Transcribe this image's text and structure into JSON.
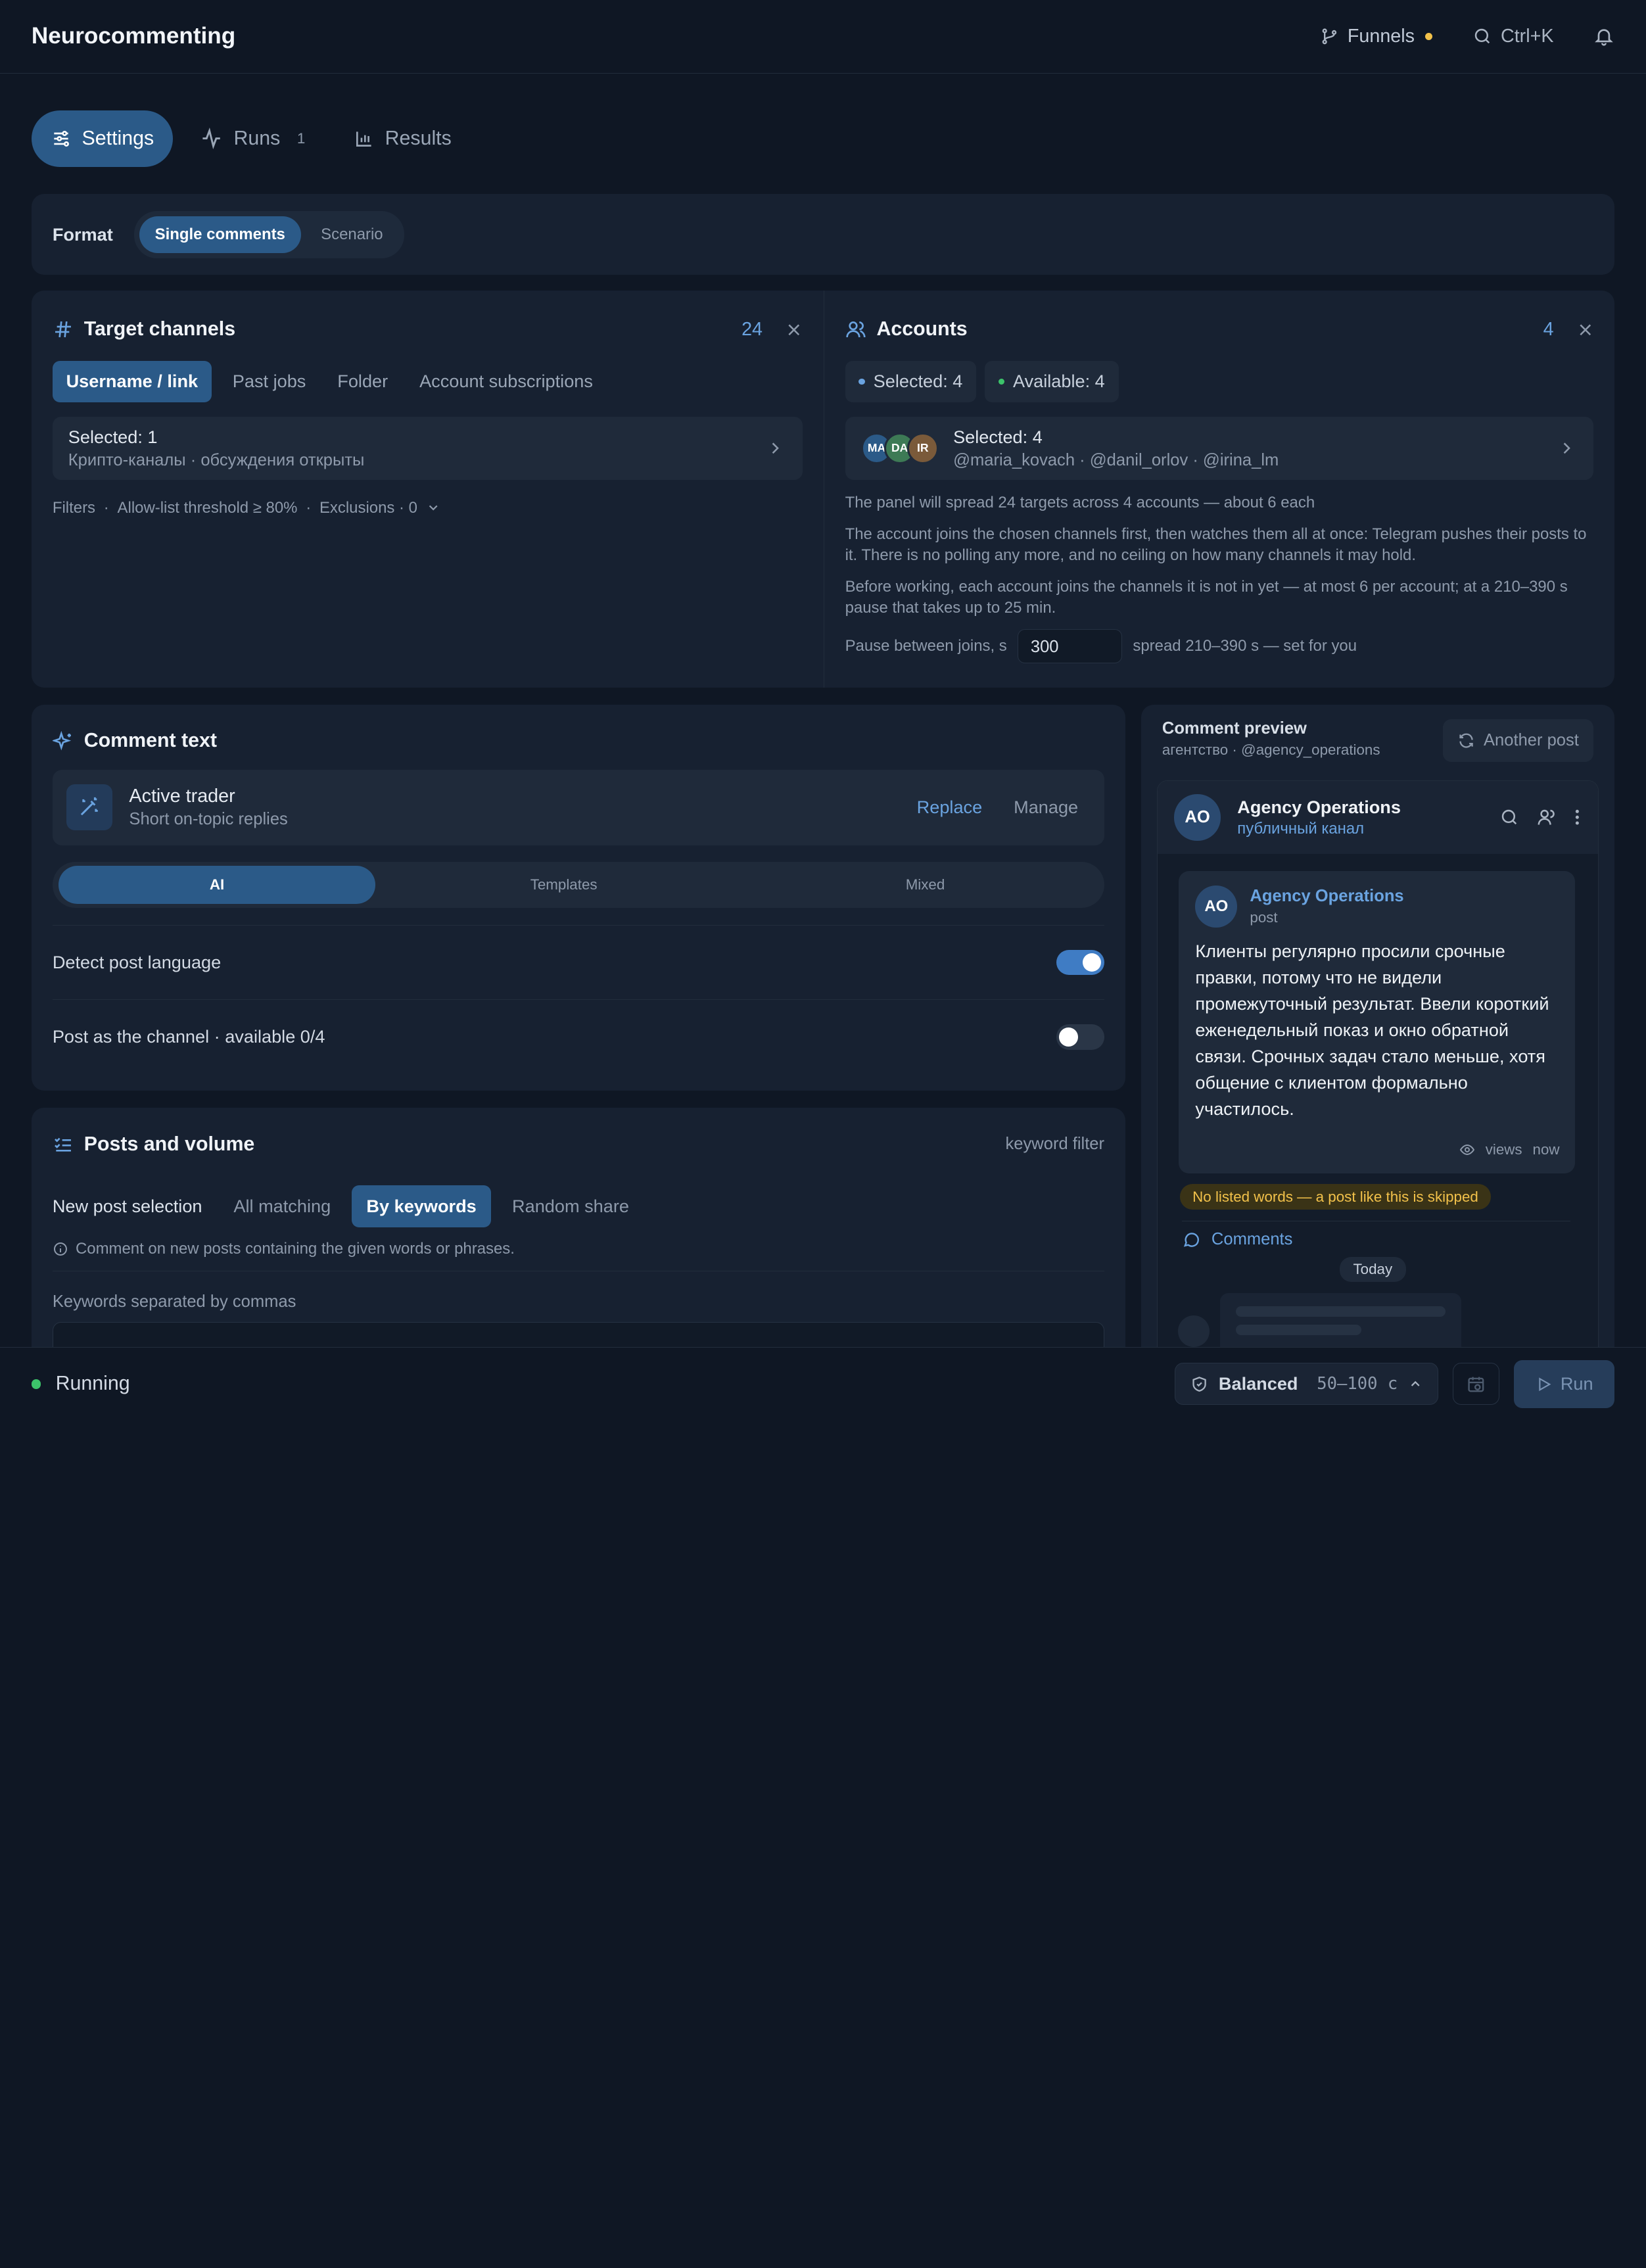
{
  "app": {
    "title": "Neurocommenting"
  },
  "topbar": {
    "funnels": "Funnels",
    "search_shortcut": "Ctrl+K"
  },
  "tabs": [
    {
      "label": "Settings"
    },
    {
      "label": "Runs",
      "count": "1"
    },
    {
      "label": "Results"
    }
  ],
  "format": {
    "label": "Format",
    "options": [
      "Single comments",
      "Scenario"
    ],
    "selected": "Single comments"
  },
  "targets": {
    "title": "Target channels",
    "count": "24",
    "subtabs": [
      "Username / link",
      "Past jobs",
      "Folder",
      "Account subscriptions"
    ],
    "selected_title": "Selected: 1",
    "selected_desc": "Крипто-каналы · обсуждения открыты",
    "filters": [
      "Filters",
      "Allow-list threshold ≥ 80%",
      "Exclusions · 0"
    ]
  },
  "accounts": {
    "title": "Accounts",
    "count": "4",
    "chip_selected": "Selected: 4",
    "chip_available": "Available: 4",
    "avatars": [
      "MA",
      "DA",
      "IR"
    ],
    "selected_title": "Selected: 4",
    "selected_desc": "@maria_kovach · @danil_orlov · @irina_lm",
    "note1": "The panel will spread 24 targets across 4 accounts — about 6 each",
    "note2": "The account joins the chosen channels first, then watches them all at once: Telegram pushes their posts to it. There is no polling any more, and no ceiling on how many channels it may hold.",
    "note3": "Before working, each account joins the channels it is not in yet — at most 6 per account; at a 210–390 s pause that takes up to 25 min.",
    "pause_label": "Pause between joins, s",
    "pause_value": "300",
    "pause_hint": "spread 210–390 s — set for you"
  },
  "comment_text": {
    "title": "Comment text",
    "persona_name": "Active trader",
    "persona_desc": "Short on-topic replies",
    "replace": "Replace",
    "manage": "Manage",
    "modes": [
      "AI",
      "Templates",
      "Mixed"
    ],
    "selected_mode": "AI",
    "detect_language": "Detect post language",
    "detect_language_on": true,
    "post_as_channel": "Post as the channel · available 0/4",
    "post_as_channel_on": false
  },
  "posts": {
    "title": "Posts and volume",
    "right_label": "keyword filter",
    "selection_label": "New post selection",
    "options": [
      "All matching",
      "By keywords",
      "Random share"
    ],
    "selected_option": "By keywords",
    "hint": "Comment on new posts containing the given words or phrases.",
    "keywords_label": "Keywords separated by commas"
  },
  "preview": {
    "title": "Comment preview",
    "subtitle": "агентство · @agency_operations",
    "another_post": "Another post",
    "channel_name": "Agency Operations",
    "channel_type": "публичный канал",
    "avatar": "AO",
    "post_author": "Agency Operations",
    "post_kind": "post",
    "post_text": "Клиенты регулярно просили срочные правки, потому что не видели промежуточный результат. Ввели короткий еженедельный показ и окно обратной связи. Срочных задач стало меньше, хотя общение с клиентом формально участилось.",
    "views": "views",
    "time": "now",
    "warning": "No listed words — a post like this is skipped",
    "comments": "Comments",
    "today": "Today"
  },
  "footer": {
    "status": "Running",
    "profile": "Balanced",
    "range": "50–100 с",
    "run": "Run"
  },
  "colors": {
    "accent": "#2b5a88",
    "link": "#6aa3e0",
    "warning": "#f2c14a",
    "running": "#3cc36a"
  }
}
